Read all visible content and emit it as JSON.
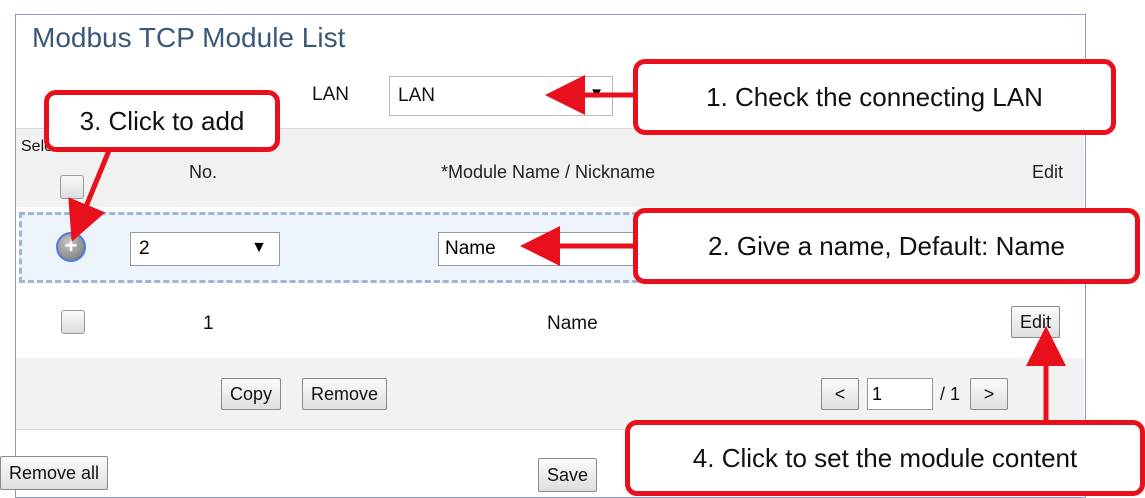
{
  "page": {
    "title": "Modbus TCP Module List",
    "lan_label": "LAN",
    "lan_value": "LAN",
    "select_all_label": "Select All",
    "headers": {
      "no": "No.",
      "name": "*Module Name / Nickname",
      "edit": "Edit"
    },
    "add_row": {
      "no_value": "2",
      "name_value": "Name"
    },
    "rows": [
      {
        "no": "1",
        "name": "Name",
        "edit_label": "Edit"
      }
    ],
    "buttons": {
      "copy": "Copy",
      "remove": "Remove",
      "remove_all": "Remove all",
      "save": "Save"
    },
    "pagination": {
      "prev": "<",
      "next": ">",
      "current": "1",
      "total": "/ 1"
    }
  },
  "callouts": {
    "c1": "1.  Check the connecting LAN",
    "c2": "2. Give a name, Default: Name",
    "c3": "3. Click to add",
    "c4": "4. Click to set the module content"
  },
  "icons": {
    "add": "plus-circle-icon",
    "dropdown": "caret-down-icon"
  },
  "colors": {
    "annotation_red": "#e8101c",
    "title": "#3b5878",
    "add_row_bg": "#eef4fb",
    "add_row_border": "#9fb5d4"
  }
}
